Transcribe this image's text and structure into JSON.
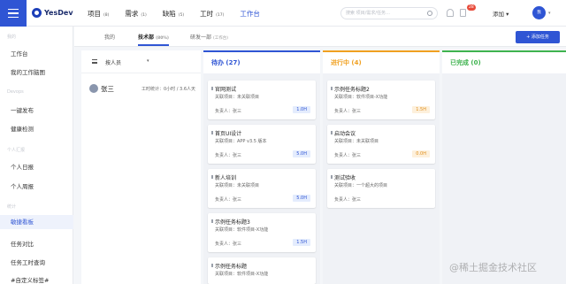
{
  "brand": {
    "name": "YesDev"
  },
  "nav": [
    {
      "label": "项目",
      "count": "(8)"
    },
    {
      "label": "需求",
      "count": "(1)"
    },
    {
      "label": "缺陷",
      "count": "(5)"
    },
    {
      "label": "工时",
      "count": "(17)"
    },
    {
      "label": "工作台",
      "count": ""
    }
  ],
  "search": {
    "placeholder": "搜索 项目/需求/任务…"
  },
  "header": {
    "notif_count": "28",
    "add_label": "添加 ▾",
    "avatar_text": "我"
  },
  "sidebar": {
    "groups": [
      {
        "label": "我的",
        "items": [
          "工作台",
          "我的工作脑图"
        ]
      },
      {
        "label": "Devops",
        "items": [
          "一键发布",
          "健康检测"
        ]
      },
      {
        "label": "个人汇报",
        "items": [
          "个人日报",
          "个人周报"
        ]
      },
      {
        "label": "统计",
        "items": [
          "敏捷看板",
          "任务对比",
          "任务工时查询",
          "#自定义标签#"
        ]
      }
    ],
    "active": "敏捷看板"
  },
  "tabs": [
    {
      "label": "我的",
      "count": ""
    },
    {
      "label": "技术部",
      "count": "(80%)"
    },
    {
      "label": "研发一部",
      "count": "(工作台)"
    }
  ],
  "add_task_label": "+ 添加任务",
  "board": {
    "assignee_label": "按人员",
    "person": {
      "name": "张三",
      "stat": "工时统计：0小时 / 3.6人天"
    },
    "columns": [
      {
        "title": "待办 (27)",
        "color": "#2f55d4"
      },
      {
        "title": "进行中 (4)",
        "color": "#f0a020"
      },
      {
        "title": "已完成 (0)",
        "color": "#3fb34f"
      }
    ],
    "todo": [
      {
        "title": "官网测试",
        "project": "关联项目：未关联项目",
        "owner": "负责人：张三",
        "hours": "1.0H"
      },
      {
        "title": "首页UI设计",
        "project": "关联项目：APP v3.5 版本",
        "owner": "负责人：张三",
        "hours": "5.0H"
      },
      {
        "title": "新人培训",
        "project": "关联项目：未关联项目",
        "owner": "负责人：张三",
        "hours": "5.0H"
      },
      {
        "title": "示例任务标题3",
        "project": "关联项目：软件项目-X功能",
        "owner": "负责人：张三",
        "hours": "1.5H"
      },
      {
        "title": "示例任务标题",
        "project": "关联项目：软件项目-X功能",
        "owner": "",
        "hours": ""
      }
    ],
    "doing": [
      {
        "title": "示例任务标题2",
        "project": "关联项目：软件项目-X功能",
        "owner": "负责人：张三",
        "hours": "1.5H"
      },
      {
        "title": "启动会议",
        "project": "关联项目：未关联项目",
        "owner": "负责人：张三",
        "hours": "0.0H"
      },
      {
        "title": "测试验收",
        "project": "关联项目：一个超大的项目",
        "owner": "负责人：张三",
        "hours": ""
      }
    ]
  },
  "watermark": "@稀土掘金技术社区"
}
